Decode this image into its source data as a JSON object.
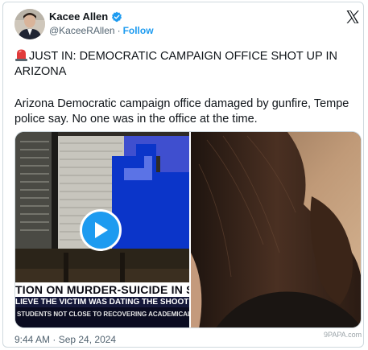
{
  "author": {
    "display_name": "Kacee Allen",
    "handle": "@KaceeRAllen",
    "separator": "·",
    "follow_label": "Follow"
  },
  "post": {
    "headline": "JUST IN: DEMOCRATIC CAMPAIGN OFFICE SHOT UP IN ARIZONA",
    "body": "Arizona Democratic campaign office damaged by gunfire, Tempe police say. No one was in the office at the time.",
    "timestamp": "9:44 AM · Sep 24, 2024"
  },
  "media": {
    "ticker_main": "TION ON MURDER-SUICIDE IN SU",
    "ticker_sub": "LIEVE THE VICTIM WAS DATING THE SHOOTE",
    "ticker_bottom": "STUDENTS NOT CLOSE TO RECOVERING ACADEMICALLY A"
  },
  "watermark": "9PAPA.com",
  "icons": [
    "verified-badge-icon",
    "x-logo-icon",
    "siren-icon",
    "play-icon"
  ],
  "colors": {
    "accent": "#1d9bf0",
    "text": "#0f1419",
    "muted": "#536471"
  }
}
